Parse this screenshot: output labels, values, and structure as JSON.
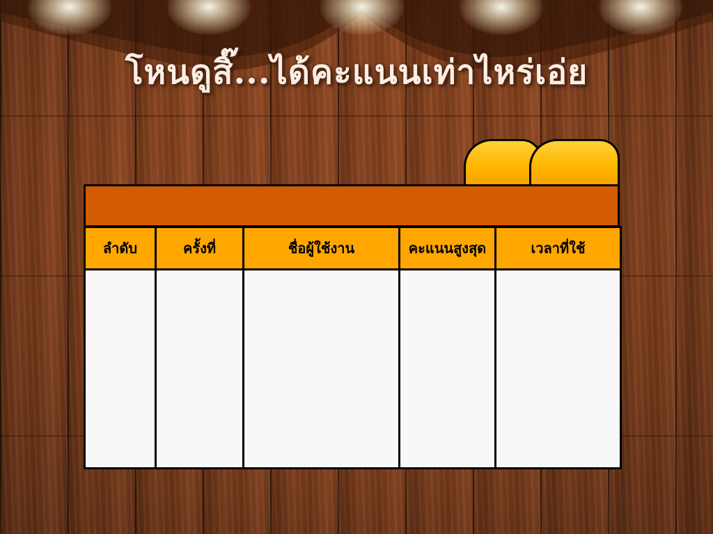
{
  "title": "โหนดูสิ๊...ได้คะแนนเท่าไหร่เอ่ย",
  "table": {
    "columns": [
      "ลำดับ",
      "ครั้งที่",
      "ชื่อผู้ใช้งาน",
      "คะแนนสูงสุด",
      "เวลาที่ใช้"
    ]
  },
  "colors": {
    "header_bar": "#d35c00",
    "column_header": "#ffa700",
    "tab": "#ffb400",
    "cell_background": "#f8f8f8",
    "wood": "#7b3d1c"
  },
  "icons": [
    "spotlight",
    "folder-tab"
  ]
}
